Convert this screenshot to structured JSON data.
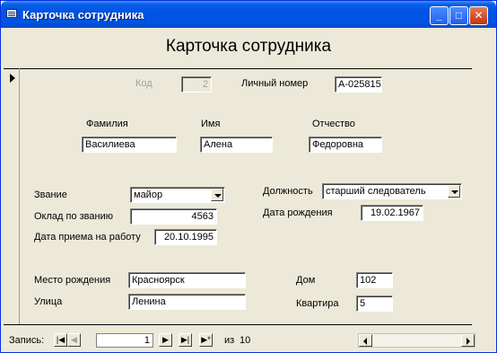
{
  "window": {
    "title": "Карточка сотрудника"
  },
  "form": {
    "title": "Карточка сотрудника",
    "kod": {
      "label": "Код",
      "value": "2"
    },
    "personal_number": {
      "label": "Личный номер",
      "value": "А-025815"
    },
    "surname": {
      "label": "Фамилия",
      "value": "Василиева"
    },
    "name": {
      "label": "Имя",
      "value": "Алена"
    },
    "patronymic": {
      "label": "Отчество",
      "value": "Федоровна"
    },
    "rank": {
      "label": "Звание",
      "value": "майор"
    },
    "position": {
      "label": "Должность",
      "value": "старший следователь"
    },
    "salary": {
      "label": "Оклад по званию",
      "value": "4563"
    },
    "birth_date": {
      "label": "Дата рождения",
      "value": "19.02.1967"
    },
    "hire_date": {
      "label": "Дата приема на работу",
      "value": "20.10.1995"
    },
    "birth_place": {
      "label": "Место рождения",
      "value": "Красноярск"
    },
    "street": {
      "label": "Улица",
      "value": "Ленина"
    },
    "house": {
      "label": "Дом",
      "value": "102"
    },
    "apartment": {
      "label": "Квартира",
      "value": "5"
    }
  },
  "navigation": {
    "label": "Запись:",
    "current": "1",
    "of_label": "из",
    "total": "10",
    "first_glyph": "|◀",
    "prev_glyph": "◀",
    "next_glyph": "▶",
    "last_glyph": "▶|",
    "new_glyph": "▶*"
  },
  "icons": [
    "form-icon",
    "minimize-icon",
    "maximize-icon",
    "close-icon",
    "record-selector-icon",
    "dropdown-arrow-icon",
    "scroll-left-icon",
    "scroll-right-icon"
  ]
}
